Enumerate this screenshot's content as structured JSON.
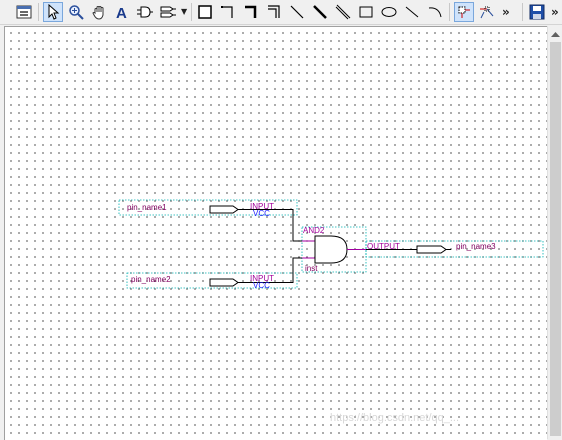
{
  "toolbar": {
    "tools": [
      {
        "name": "maximize-icon"
      },
      {
        "name": "selection-tool-icon",
        "active": true
      },
      {
        "name": "zoom-tool-icon"
      },
      {
        "name": "hand-tool-icon"
      },
      {
        "name": "text-tool-icon"
      },
      {
        "name": "symbol-tool-icon"
      },
      {
        "name": "pin-tool-icon"
      },
      {
        "name": "block-tool-icon"
      },
      {
        "name": "orthogonal-node-tool-icon"
      },
      {
        "name": "orthogonal-bus-tool-icon"
      },
      {
        "name": "orthogonal-conduit-tool-icon"
      },
      {
        "name": "diagonal-node-tool-icon"
      },
      {
        "name": "diagonal-bus-tool-icon"
      },
      {
        "name": "diagonal-conduit-tool-icon"
      },
      {
        "name": "rectangle-tool-icon"
      },
      {
        "name": "oval-tool-icon"
      },
      {
        "name": "line-tool-icon"
      },
      {
        "name": "arc-tool-icon"
      },
      {
        "name": "rubberbanding-icon",
        "active": true
      },
      {
        "name": "partial-line-selection-icon"
      },
      {
        "name": "save-icon"
      }
    ],
    "more_glyph": "»",
    "more_glyph_2": "»"
  },
  "schematic": {
    "input_pin_1": {
      "name": "pin_name1",
      "type": "INPUT",
      "default": "VCC"
    },
    "input_pin_2": {
      "name": "pin_name2",
      "type": "INPUT",
      "default": "VCC"
    },
    "gate": {
      "type": "AND2",
      "instance": "inst"
    },
    "output_pin": {
      "name": "pin_name3",
      "type": "OUTPUT"
    }
  },
  "watermark": "https://blog.csdn.net/qq_..."
}
